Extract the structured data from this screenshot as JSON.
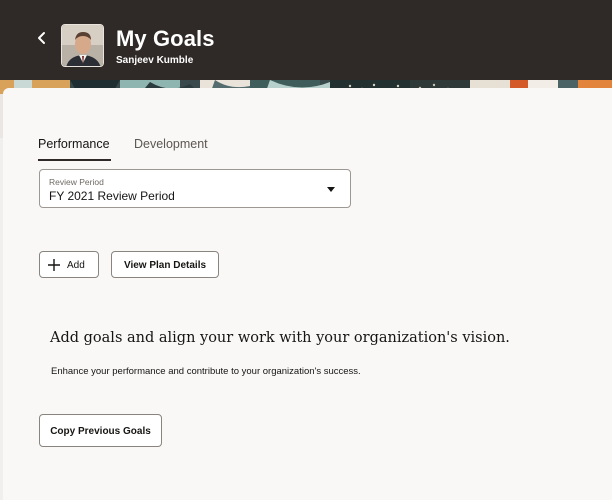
{
  "header": {
    "title": "My Goals",
    "subtitle": "Sanjeev Kumble",
    "back_icon": "chevron-left-icon",
    "avatar_icon": "user-avatar"
  },
  "tabs": [
    {
      "label": "Performance",
      "selected": true
    },
    {
      "label": "Development",
      "selected": false
    }
  ],
  "review_period": {
    "label": "Review Period",
    "value": "FY 2021 Review Period",
    "icon": "caret-down-icon"
  },
  "actions": {
    "add_label": "Add",
    "add_icon": "plus-icon",
    "view_plan_label": "View Plan Details"
  },
  "empty_state": {
    "title": "Add goals and align your work with your organization's vision.",
    "subtitle": "Enhance your performance and contribute to your organization's success.",
    "copy_button_label": "Copy Previous Goals"
  },
  "colors": {
    "header_bg": "#2f2a27",
    "card_bg": "#f9f8f6",
    "text_primary": "#161513"
  }
}
